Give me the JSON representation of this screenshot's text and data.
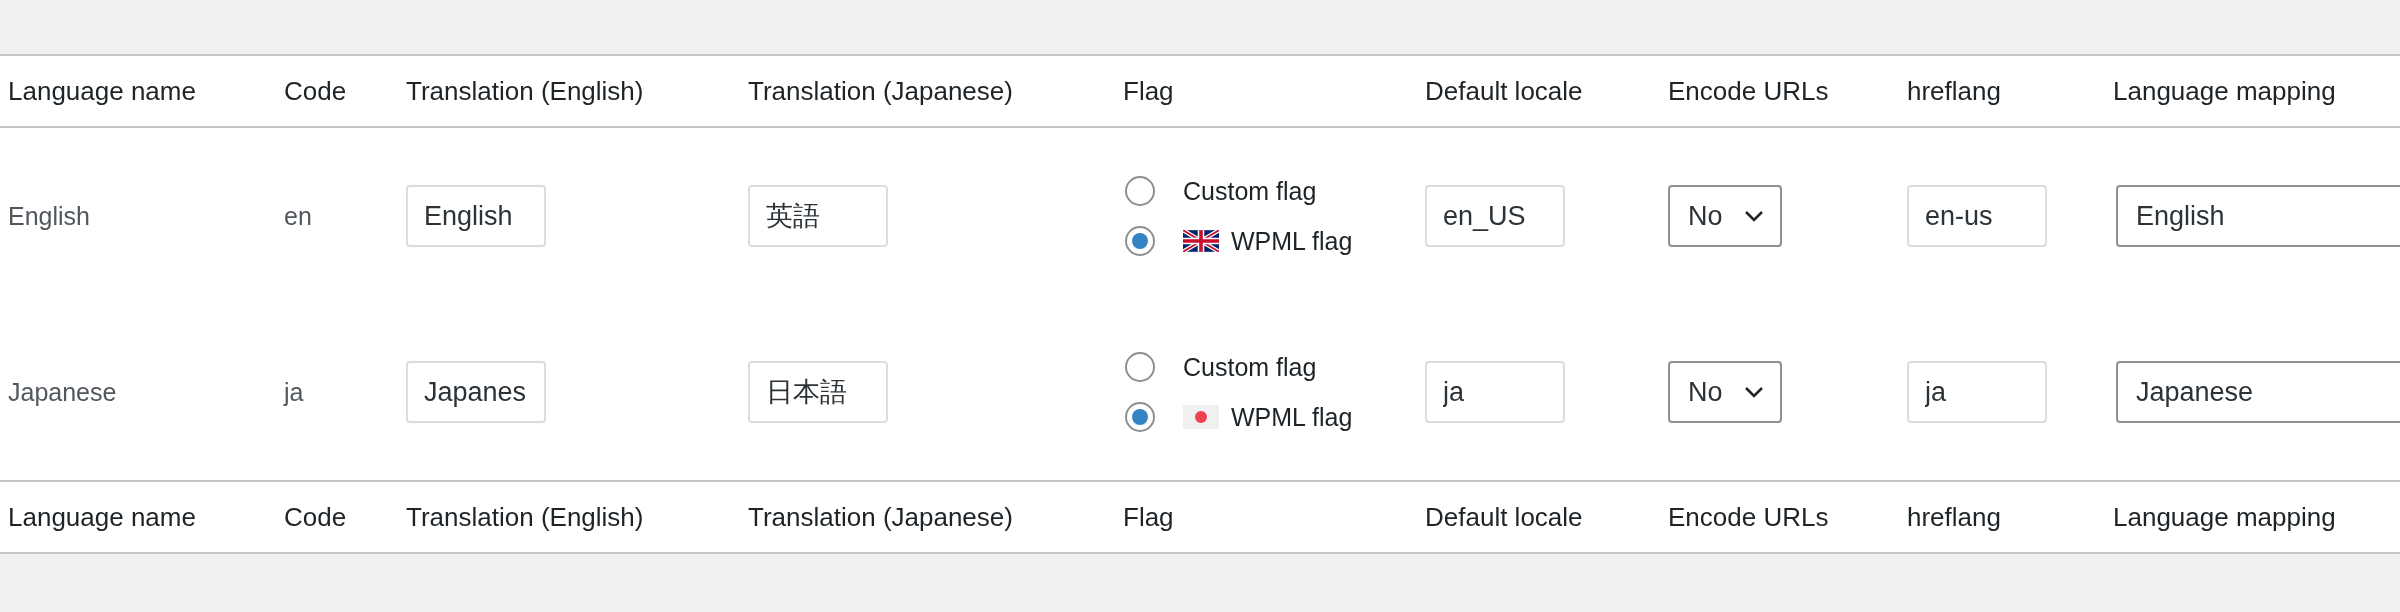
{
  "columns": [
    "Language name",
    "Code",
    "Translation (English)",
    "Translation (Japanese)",
    "Flag",
    "Default locale",
    "Encode URLs",
    "hreflang",
    "Language mapping"
  ],
  "rows": [
    {
      "name": "English",
      "code": "en",
      "translation_english": "English",
      "translation_japanese": "英語",
      "flag_options": [
        {
          "kind": "custom",
          "label": "Custom flag",
          "selected": false
        },
        {
          "kind": "gb",
          "label": "WPML flag",
          "selected": true
        }
      ],
      "default_locale": "en_US",
      "encode_urls": "No",
      "hreflang": "en-us",
      "language_mapping": "English"
    },
    {
      "name": "Japanese",
      "code": "ja",
      "translation_english": "Japanes",
      "translation_japanese": "日本語",
      "flag_options": [
        {
          "kind": "custom",
          "label": "Custom flag",
          "selected": false
        },
        {
          "kind": "jp",
          "label": "WPML flag",
          "selected": true
        }
      ],
      "default_locale": "ja",
      "encode_urls": "No",
      "hreflang": "ja",
      "language_mapping": "Japanese"
    }
  ],
  "footer_columns": [
    "Language name",
    "Code",
    "Translation (English)",
    "Translation (Japanese)",
    "Flag",
    "Default locale",
    "Encode URLs",
    "hreflang",
    "Language mapping"
  ]
}
